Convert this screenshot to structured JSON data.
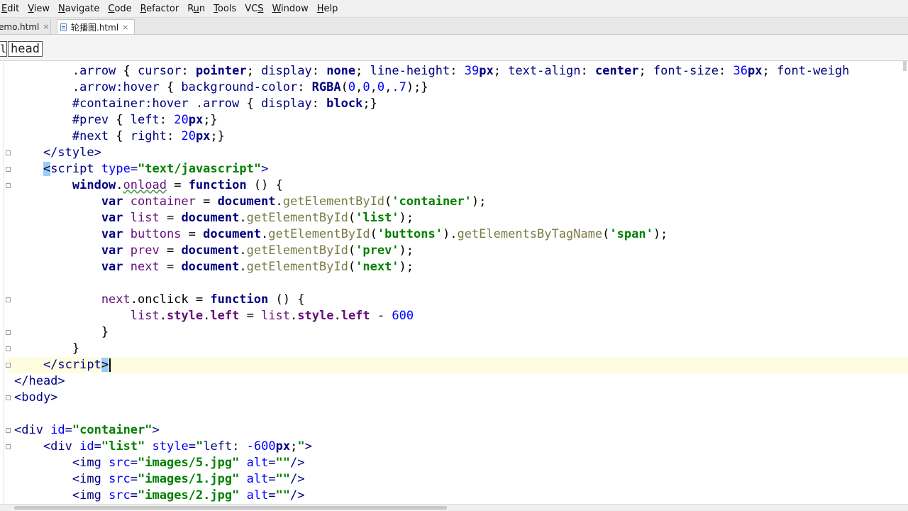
{
  "menubar": {
    "items": [
      {
        "label": "Edit",
        "mnemonic": "E"
      },
      {
        "label": "View",
        "mnemonic": "V"
      },
      {
        "label": "Navigate",
        "mnemonic": "N"
      },
      {
        "label": "Code",
        "mnemonic": "C"
      },
      {
        "label": "Refactor",
        "mnemonic": "R"
      },
      {
        "label": "Run",
        "mnemonic": "u"
      },
      {
        "label": "Tools",
        "mnemonic": "T"
      },
      {
        "label": "VCS",
        "mnemonic": "S"
      },
      {
        "label": "Window",
        "mnemonic": "W"
      },
      {
        "label": "Help",
        "mnemonic": "H"
      }
    ]
  },
  "tabs": [
    {
      "label": "emo.html",
      "close": "×",
      "active": false
    },
    {
      "label": "轮播图.html",
      "close": "×",
      "active": true,
      "icon": "html-file-icon"
    }
  ],
  "breadcrumb": {
    "left_partial": "l",
    "current": "head"
  },
  "code": {
    "lines": [
      [
        [
          "t-sel",
          "        .arrow "
        ],
        [
          "t-plain",
          "{ "
        ],
        [
          "t-prop",
          "cursor"
        ],
        [
          "t-plain",
          ": "
        ],
        [
          "t-val",
          "pointer"
        ],
        [
          "t-plain",
          "; "
        ],
        [
          "t-prop",
          "display"
        ],
        [
          "t-plain",
          ": "
        ],
        [
          "t-val",
          "none"
        ],
        [
          "t-plain",
          "; "
        ],
        [
          "t-prop",
          "line-height"
        ],
        [
          "t-plain",
          ": "
        ],
        [
          "t-num",
          "39"
        ],
        [
          "t-val",
          "px"
        ],
        [
          "t-plain",
          "; "
        ],
        [
          "t-prop",
          "text-align"
        ],
        [
          "t-plain",
          ": "
        ],
        [
          "t-val",
          "center"
        ],
        [
          "t-plain",
          "; "
        ],
        [
          "t-prop",
          "font-size"
        ],
        [
          "t-plain",
          ": "
        ],
        [
          "t-num",
          "36"
        ],
        [
          "t-val",
          "px"
        ],
        [
          "t-plain",
          "; "
        ],
        [
          "t-prop",
          "font-weigh"
        ]
      ],
      [
        [
          "t-sel",
          "        .arrow:hover "
        ],
        [
          "t-plain",
          "{ "
        ],
        [
          "t-prop",
          "background-color"
        ],
        [
          "t-plain",
          ": "
        ],
        [
          "t-val",
          "RGBA"
        ],
        [
          "t-plain",
          "("
        ],
        [
          "t-num",
          "0"
        ],
        [
          "t-plain",
          ","
        ],
        [
          "t-num",
          "0"
        ],
        [
          "t-plain",
          ","
        ],
        [
          "t-num",
          "0"
        ],
        [
          "t-plain",
          ","
        ],
        [
          "t-num",
          ".7"
        ],
        [
          "t-plain",
          ");}"
        ]
      ],
      [
        [
          "t-sel",
          "        #container:hover .arrow "
        ],
        [
          "t-plain",
          "{ "
        ],
        [
          "t-prop",
          "display"
        ],
        [
          "t-plain",
          ": "
        ],
        [
          "t-val",
          "block"
        ],
        [
          "t-plain",
          ";}"
        ]
      ],
      [
        [
          "t-sel",
          "        #prev "
        ],
        [
          "t-plain",
          "{ "
        ],
        [
          "t-prop",
          "left"
        ],
        [
          "t-plain",
          ": "
        ],
        [
          "t-num",
          "20"
        ],
        [
          "t-val",
          "px"
        ],
        [
          "t-plain",
          ";}"
        ]
      ],
      [
        [
          "t-sel",
          "        #next "
        ],
        [
          "t-plain",
          "{ "
        ],
        [
          "t-prop",
          "right"
        ],
        [
          "t-plain",
          ": "
        ],
        [
          "t-num",
          "20"
        ],
        [
          "t-val",
          "px"
        ],
        [
          "t-plain",
          ";}"
        ]
      ],
      [
        [
          "t-tag",
          "    </style>"
        ]
      ],
      [
        [
          "t-plain",
          "    "
        ],
        [
          "t-bracket-hi",
          "<"
        ],
        [
          "t-tag",
          "script "
        ],
        [
          "t-attr",
          "type"
        ],
        [
          "t-tag",
          "="
        ],
        [
          "t-str",
          "\"text/javascript\""
        ],
        [
          "t-tag",
          ">"
        ]
      ],
      [
        [
          "t-kw",
          "        window"
        ],
        [
          "t-plain",
          "."
        ],
        [
          "t-var",
          "onload"
        ],
        [
          "t-plain",
          " = "
        ],
        [
          "t-kw",
          "function "
        ],
        [
          "t-plain",
          "() {"
        ]
      ],
      [
        [
          "t-kw",
          "            var "
        ],
        [
          "t-var",
          "container"
        ],
        [
          "t-plain",
          " = "
        ],
        [
          "t-kw",
          "document"
        ],
        [
          "t-plain",
          "."
        ],
        [
          "t-fn",
          "getElementById"
        ],
        [
          "t-plain",
          "("
        ],
        [
          "t-str",
          "'container'"
        ],
        [
          "t-plain",
          ");"
        ]
      ],
      [
        [
          "t-kw",
          "            var "
        ],
        [
          "t-var",
          "list"
        ],
        [
          "t-plain",
          " = "
        ],
        [
          "t-kw",
          "document"
        ],
        [
          "t-plain",
          "."
        ],
        [
          "t-fn",
          "getElementById"
        ],
        [
          "t-plain",
          "("
        ],
        [
          "t-str",
          "'list'"
        ],
        [
          "t-plain",
          ");"
        ]
      ],
      [
        [
          "t-kw",
          "            var "
        ],
        [
          "t-var",
          "buttons"
        ],
        [
          "t-plain",
          " = "
        ],
        [
          "t-kw",
          "document"
        ],
        [
          "t-plain",
          "."
        ],
        [
          "t-fn",
          "getElementById"
        ],
        [
          "t-plain",
          "("
        ],
        [
          "t-str",
          "'buttons'"
        ],
        [
          "t-plain",
          ")."
        ],
        [
          "t-fn",
          "getElementsByTagName"
        ],
        [
          "t-plain",
          "("
        ],
        [
          "t-str",
          "'span'"
        ],
        [
          "t-plain",
          ");"
        ]
      ],
      [
        [
          "t-kw",
          "            var "
        ],
        [
          "t-var",
          "prev"
        ],
        [
          "t-plain",
          " = "
        ],
        [
          "t-kw",
          "document"
        ],
        [
          "t-plain",
          "."
        ],
        [
          "t-fn",
          "getElementById"
        ],
        [
          "t-plain",
          "("
        ],
        [
          "t-str",
          "'prev'"
        ],
        [
          "t-plain",
          ");"
        ]
      ],
      [
        [
          "t-kw",
          "            var "
        ],
        [
          "t-var",
          "next"
        ],
        [
          "t-plain",
          " = "
        ],
        [
          "t-kw",
          "document"
        ],
        [
          "t-plain",
          "."
        ],
        [
          "t-fn",
          "getElementById"
        ],
        [
          "t-plain",
          "("
        ],
        [
          "t-str",
          "'next'"
        ],
        [
          "t-plain",
          ");"
        ]
      ],
      [
        [
          "t-plain",
          ""
        ]
      ],
      [
        [
          "t-var",
          "            next"
        ],
        [
          "t-plain",
          ".onclick = "
        ],
        [
          "t-kw",
          "function "
        ],
        [
          "t-plain",
          "() {"
        ]
      ],
      [
        [
          "t-var",
          "                list"
        ],
        [
          "t-plain",
          "."
        ],
        [
          "t-field",
          "style"
        ],
        [
          "t-plain",
          "."
        ],
        [
          "t-field",
          "left"
        ],
        [
          "t-plain",
          " = "
        ],
        [
          "t-var",
          "list"
        ],
        [
          "t-plain",
          "."
        ],
        [
          "t-field",
          "style"
        ],
        [
          "t-plain",
          "."
        ],
        [
          "t-field",
          "left"
        ],
        [
          "t-plain",
          " - "
        ],
        [
          "t-num",
          "600"
        ]
      ],
      [
        [
          "t-plain",
          "            }"
        ]
      ],
      [
        [
          "t-plain",
          "        }"
        ]
      ],
      [
        [
          "t-tag",
          "    </script"
        ],
        [
          "t-bracket-hi",
          ">"
        ]
      ],
      [
        [
          "t-tag",
          "</head>"
        ]
      ],
      [
        [
          "t-tag",
          "<body>"
        ]
      ],
      [
        [
          "t-plain",
          ""
        ]
      ],
      [
        [
          "t-tag",
          "<div "
        ],
        [
          "t-attr",
          "id"
        ],
        [
          "t-tag",
          "="
        ],
        [
          "t-str",
          "\"container\""
        ],
        [
          "t-tag",
          ">"
        ]
      ],
      [
        [
          "t-tag",
          "    <div "
        ],
        [
          "t-attr",
          "id"
        ],
        [
          "t-tag",
          "="
        ],
        [
          "t-str",
          "\"list\" "
        ],
        [
          "t-attr",
          "style"
        ],
        [
          "t-tag",
          "="
        ],
        [
          "t-str",
          "\""
        ],
        [
          "t-prop",
          "left"
        ],
        [
          "t-plain",
          ": "
        ],
        [
          "t-num",
          "-600"
        ],
        [
          "t-val",
          "px"
        ],
        [
          "t-plain",
          ";"
        ],
        [
          "t-str",
          "\""
        ],
        [
          "t-tag",
          ">"
        ]
      ],
      [
        [
          "t-tag",
          "        <img "
        ],
        [
          "t-attr",
          "src"
        ],
        [
          "t-tag",
          "="
        ],
        [
          "t-str",
          "\"images/5.jpg\" "
        ],
        [
          "t-attr",
          "alt"
        ],
        [
          "t-tag",
          "="
        ],
        [
          "t-str",
          "\"\""
        ],
        [
          "t-tag",
          "/>"
        ]
      ],
      [
        [
          "t-tag",
          "        <img "
        ],
        [
          "t-attr",
          "src"
        ],
        [
          "t-tag",
          "="
        ],
        [
          "t-str",
          "\"images/1.jpg\" "
        ],
        [
          "t-attr",
          "alt"
        ],
        [
          "t-tag",
          "="
        ],
        [
          "t-str",
          "\"\""
        ],
        [
          "t-tag",
          "/>"
        ]
      ],
      [
        [
          "t-tag",
          "        <img "
        ],
        [
          "t-attr",
          "src"
        ],
        [
          "t-tag",
          "="
        ],
        [
          "t-str",
          "\"images/2.jpg\" "
        ],
        [
          "t-attr",
          "alt"
        ],
        [
          "t-tag",
          "="
        ],
        [
          "t-str",
          "\"\""
        ],
        [
          "t-tag",
          "/>"
        ]
      ]
    ],
    "current_line_index": 18
  }
}
